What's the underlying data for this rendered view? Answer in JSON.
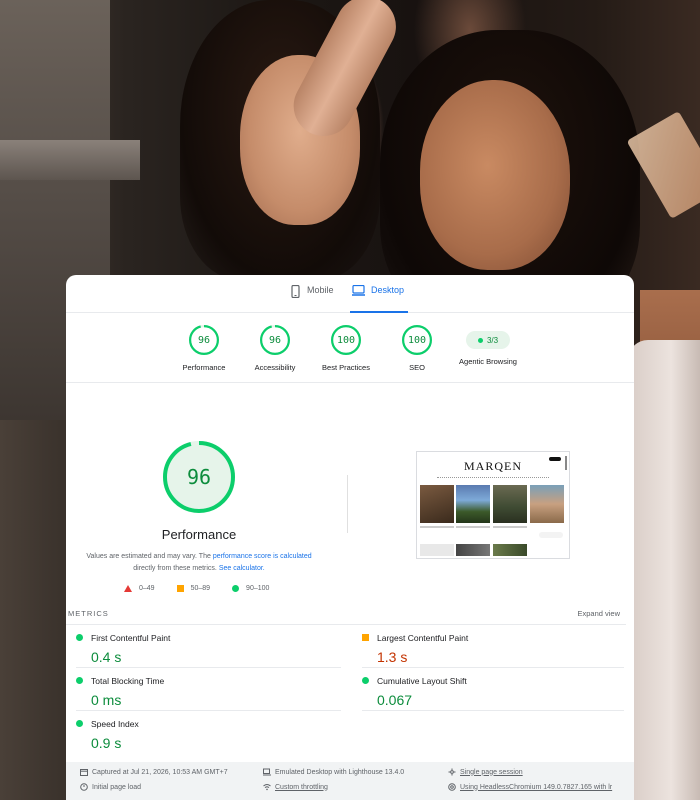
{
  "tabs": [
    {
      "label": "Mobile",
      "icon": "mobile-icon",
      "active": false
    },
    {
      "label": "Desktop",
      "icon": "desktop-icon",
      "active": true
    }
  ],
  "categories": [
    {
      "score": "96",
      "label": "Performance",
      "fraction": 0.96
    },
    {
      "score": "96",
      "label": "Accessibility",
      "fraction": 0.96
    },
    {
      "score": "100",
      "label": "Best Practices",
      "fraction": 1.0
    },
    {
      "score": "100",
      "label": "SEO",
      "fraction": 1.0
    },
    {
      "score": "3/3",
      "label": "Agentic Browsing"
    }
  ],
  "performance": {
    "score": "96",
    "fraction": 0.96,
    "title": "Performance",
    "note_part1": "Values are estimated and may vary. The ",
    "note_link1": "performance score is calculated",
    "note_part2": " directly from these metrics. ",
    "note_link2": "See calculator."
  },
  "legend": [
    {
      "shape": "triangle",
      "range": "0–49",
      "color": "#e53935"
    },
    {
      "shape": "square",
      "range": "50–89",
      "color": "#ffa400"
    },
    {
      "shape": "circle",
      "range": "90–100",
      "color": "#0cce6b"
    }
  ],
  "screenshot": {
    "logo": "MARQEN"
  },
  "metrics": {
    "header": "METRICS",
    "expand": "Expand view",
    "items": [
      {
        "name": "First Contentful Paint",
        "value": "0.4 s",
        "status": "pass"
      },
      {
        "name": "Largest Contentful Paint",
        "value": "1.3 s",
        "status": "average"
      },
      {
        "name": "Total Blocking Time",
        "value": "0 ms",
        "status": "pass"
      },
      {
        "name": "Cumulative Layout Shift",
        "value": "0.067",
        "status": "pass"
      },
      {
        "name": "Speed Index",
        "value": "0.9 s",
        "status": "pass"
      }
    ]
  },
  "footer": {
    "captured": "Captured at Jul 21, 2026, 10:53 AM GMT+7",
    "page_load": "Initial page load",
    "emulated": "Emulated Desktop with Lighthouse 13.4.0",
    "throttling": "Custom throttling",
    "session": "Single page session",
    "browser": "Using HeadlessChromium 149.0.7827.165 with lr"
  },
  "colors": {
    "pass": "#0cce6b",
    "average": "#ffa400",
    "fail": "#e53935",
    "accent": "#1a73e8"
  }
}
